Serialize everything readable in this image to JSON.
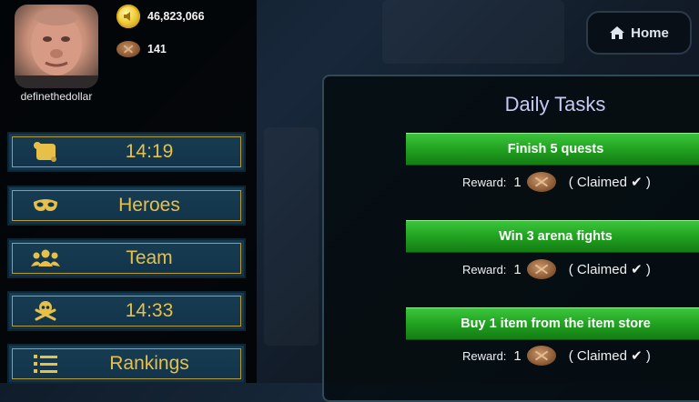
{
  "player": {
    "username": "definethedollar",
    "avatar_icon": "player-portrait",
    "coins": "46,823,066",
    "bread": "141"
  },
  "menu": [
    {
      "id": "timer-1",
      "label": "14:19",
      "icon": "scroll-icon"
    },
    {
      "id": "heroes",
      "label": "Heroes",
      "icon": "mask-icon"
    },
    {
      "id": "team",
      "label": "Team",
      "icon": "users-icon"
    },
    {
      "id": "timer-2",
      "label": "14:33",
      "icon": "skull-crossbones-icon"
    },
    {
      "id": "rankings",
      "label": "Rankings",
      "icon": "ranked-list-icon"
    }
  ],
  "home": {
    "label": "Home",
    "icon": "house-icon"
  },
  "daily_tasks": {
    "title": "Daily Tasks",
    "reward_label": "Reward:",
    "tasks": [
      {
        "name": "Finish 5 quests",
        "amount": "1",
        "status": "( Claimed ✔ )"
      },
      {
        "name": "Win 3 arena fights",
        "amount": "1",
        "status": "( Claimed ✔ )"
      },
      {
        "name": "Buy 1 item from the item store",
        "amount": "1",
        "status": "( Claimed ✔ )"
      }
    ]
  },
  "colors": {
    "menu_text": "#e7c04a",
    "task_green": "#1f9e1f",
    "panel_title": "#c7c8f3"
  }
}
